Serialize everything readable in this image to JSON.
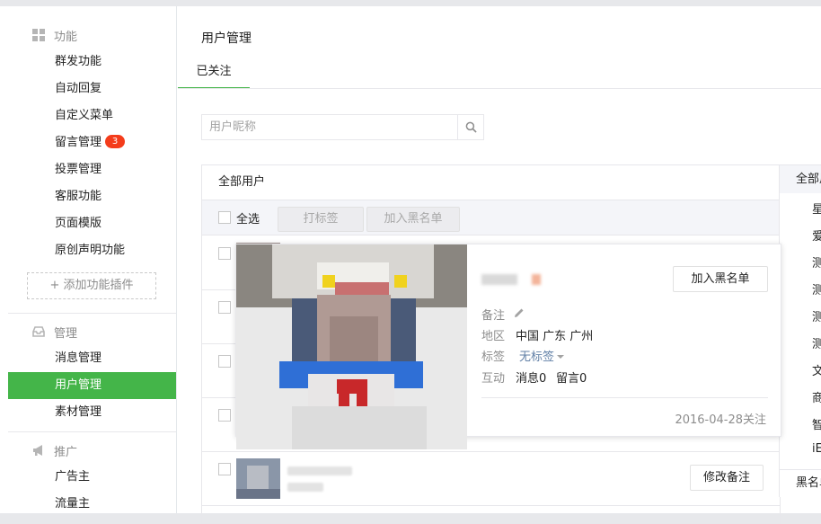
{
  "sidebar": {
    "sections": [
      {
        "name": "features",
        "icon": "grid-icon",
        "label": "功能"
      },
      {
        "name": "manage",
        "icon": "inbox-icon",
        "label": "管理"
      },
      {
        "name": "promote",
        "icon": "megaphone-icon",
        "label": "推广"
      }
    ],
    "features_items": [
      {
        "label": "群发功能"
      },
      {
        "label": "自动回复"
      },
      {
        "label": "自定义菜单"
      },
      {
        "label": "留言管理",
        "badge": "3"
      },
      {
        "label": "投票管理"
      },
      {
        "label": "客服功能"
      },
      {
        "label": "页面模版"
      },
      {
        "label": "原创声明功能"
      }
    ],
    "add_plugin": "+ 添加功能插件",
    "manage_items": [
      {
        "label": "消息管理"
      },
      {
        "label": "用户管理",
        "active": true
      },
      {
        "label": "素材管理"
      }
    ],
    "promote_items": [
      {
        "label": "广告主"
      },
      {
        "label": "流量主"
      }
    ]
  },
  "main": {
    "title": "用户管理",
    "tab": "已关注",
    "search_placeholder": "用户昵称",
    "panel_title": "全部用户",
    "select_all": "全选",
    "tag_button": "打标签",
    "blacklist_button": "加入黑名单",
    "row_buttons": [
      "修改备注"
    ]
  },
  "right_column": {
    "head": "全部用户",
    "items": [
      "星",
      "爱",
      "测",
      "测",
      "测",
      "测",
      "文",
      "商",
      "智",
      "iE"
    ],
    "foot": "黑名单"
  },
  "popup": {
    "add_blacklist": "加入黑名单",
    "remark_label": "备注",
    "region_label": "地区",
    "region_value": "中国 广东 广州",
    "tag_label": "标签",
    "tag_value": "无标签",
    "interact_label": "互动",
    "messages": "消息0",
    "comments": "留言0",
    "follow_date": "2016-04-28关注"
  },
  "colors": {
    "accent": "#44b549",
    "badge": "#f43c1b",
    "link": "#607fa6"
  }
}
